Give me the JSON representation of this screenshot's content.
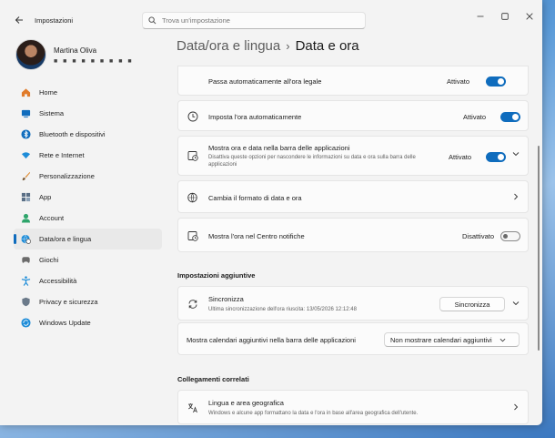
{
  "window": {
    "title": "Impostazioni"
  },
  "search": {
    "placeholder": "Trova un'impostazione"
  },
  "user": {
    "name": "Martina Oliva",
    "email": "■ ■ ■ ■ ■ ■ ■ ■ ■"
  },
  "sidebar": {
    "items": [
      {
        "label": "Home",
        "icon": "home-icon",
        "color": "#e07b2a",
        "active": false
      },
      {
        "label": "Sistema",
        "icon": "system-icon",
        "color": "#0f6cbd",
        "active": false
      },
      {
        "label": "Bluetooth e dispositivi",
        "icon": "bluetooth-icon",
        "color": "#0f6cbd",
        "active": false
      },
      {
        "label": "Rete e Internet",
        "icon": "wifi-icon",
        "color": "#1d8cd8",
        "active": false
      },
      {
        "label": "Personalizzazione",
        "icon": "brush-icon",
        "color": "#e0903a",
        "active": false
      },
      {
        "label": "App",
        "icon": "apps-icon",
        "color": "#5a6f86",
        "active": false
      },
      {
        "label": "Account",
        "icon": "account-icon",
        "color": "#2ea56b",
        "active": false
      },
      {
        "label": "Data/ora e lingua",
        "icon": "globe-clock-icon",
        "color": "#1d8cd8",
        "active": true
      },
      {
        "label": "Giochi",
        "icon": "gamepad-icon",
        "color": "#6b6b6b",
        "active": false
      },
      {
        "label": "Accessibilità",
        "icon": "accessibility-icon",
        "color": "#1d8cd8",
        "active": false
      },
      {
        "label": "Privacy e sicurezza",
        "icon": "shield-icon",
        "color": "#6b7a8a",
        "active": false
      },
      {
        "label": "Windows Update",
        "icon": "update-icon",
        "color": "#1d8cd8",
        "active": false
      }
    ]
  },
  "breadcrumb": {
    "parent": "Data/ora e lingua",
    "separator": "›",
    "current": "Data e ora"
  },
  "settings": {
    "dst": {
      "title": "Passa automaticamente all'ora legale",
      "state": "Attivato",
      "on": true
    },
    "auto_time": {
      "title": "Imposta l'ora automaticamente",
      "state": "Attivato",
      "on": true
    },
    "taskbar": {
      "title": "Mostra ora e data nella barra delle applicazioni",
      "description": "Disattiva queste opzioni per nascondere le informazioni su data e ora sulla barra delle applicazioni",
      "state": "Attivato",
      "on": true
    },
    "format": {
      "title": "Cambia il formato di data e ora"
    },
    "notification_center": {
      "title": "Mostra l'ora nel Centro notifiche",
      "state": "Disattivato",
      "on": false
    }
  },
  "additional": {
    "section_title": "Impostazioni aggiuntive",
    "sync": {
      "title": "Sincronizza",
      "description": "Ultima sincronizzazione dell'ora riuscita: 13/05/2026 12:12:48",
      "button": "Sincronizza"
    },
    "calendars": {
      "title": "Mostra calendari aggiuntivi nella barra delle applicazioni",
      "selected": "Non mostrare calendari aggiuntivi"
    }
  },
  "related": {
    "section_title": "Collegamenti correlati",
    "language_region": {
      "title": "Lingua e area geografica",
      "description": "Windows e alcune app formattano la data e l'ora in base all'area geografica dell'utente."
    }
  },
  "colors": {
    "accent": "#0f6cbd",
    "background": "#f3f3f3",
    "card": "#fbfbfb"
  }
}
